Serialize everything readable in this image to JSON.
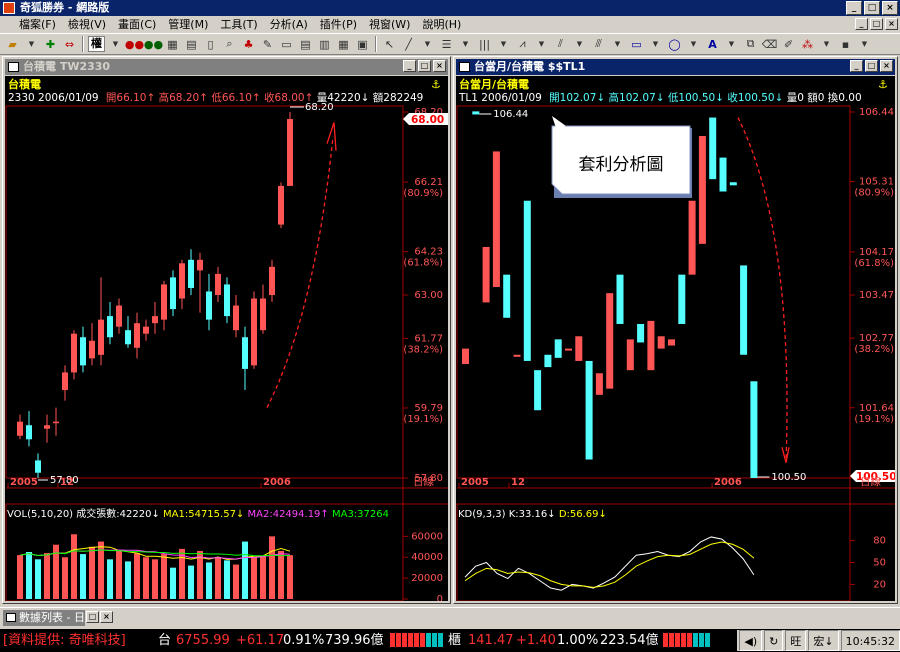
{
  "app": {
    "title": "奇狐勝券 - 網路版"
  },
  "menu": [
    "檔案(F)",
    "檢視(V)",
    "畫面(C)",
    "管理(M)",
    "工具(T)",
    "分析(A)",
    "插件(P)",
    "視窗(W)",
    "說明(H)"
  ],
  "toolbar": {
    "quan_label": "權"
  },
  "left_chart": {
    "window_title": "台積電 TW2330",
    "stock_name": "台積電",
    "info_line": {
      "code_date": "2330 2006/01/09",
      "open": "開66.10↑",
      "high": "高68.20↑",
      "low": "低66.10↑",
      "close": "收68.00↑",
      "vol": "量42220↓",
      "amt": "額282249"
    },
    "axis_labels": [
      {
        "v": "68.20",
        "pct": ""
      },
      {
        "v": "66.21",
        "pct": "(80.9%)"
      },
      {
        "v": "64.23",
        "pct": "(61.8%)"
      },
      {
        "v": "63.00",
        "pct": ""
      },
      {
        "v": "61.77",
        "pct": "(38.2%)"
      },
      {
        "v": "59.79",
        "pct": "(19.1%)"
      },
      {
        "v": "57.80",
        "pct": ""
      }
    ],
    "price_tag": "68.00",
    "high_label": "68.20",
    "low_label": "57.80",
    "x_labels": [
      "2005",
      "12",
      "2006"
    ],
    "period": "日線",
    "vol_header": {
      "title": "VOL(5,10,20) 成交張數:42220↓",
      "ma1": "MA1:54715.57↓",
      "ma2": "MA2:42494.19↑",
      "ma3": "MA3:37264"
    },
    "vol_axis": [
      "60000",
      "40000",
      "20000",
      "0"
    ]
  },
  "right_chart": {
    "window_title": "台當月/台積電 $$TL1",
    "stock_name": "台當月/台積電",
    "info_line": {
      "code_date": "TL1 2006/01/09",
      "open": "開102.07↓",
      "high": "高102.07↓",
      "low": "低100.50↓",
      "close": "收100.50↓",
      "vol": "量0",
      "amt": "額0",
      "chg": "換0.00"
    },
    "axis_labels": [
      {
        "v": "106.44",
        "pct": ""
      },
      {
        "v": "105.31",
        "pct": "(80.9%)"
      },
      {
        "v": "104.17",
        "pct": "(61.8%)"
      },
      {
        "v": "103.47",
        "pct": ""
      },
      {
        "v": "102.77",
        "pct": "(38.2%)"
      },
      {
        "v": "101.64",
        "pct": "(19.1%)"
      },
      {
        "v": "100.50",
        "pct": ""
      }
    ],
    "price_tag": "100.50",
    "high_label": "106.44",
    "low_label": "100.50",
    "x_labels": [
      "2005",
      "12",
      "2006"
    ],
    "period": "日線",
    "callout": "套利分析圖",
    "kd_header": {
      "title": "KD(9,3,3)",
      "k": "K:33.16↓",
      "d": "D:56.69↓"
    },
    "kd_axis": [
      "80",
      "50",
      "20"
    ]
  },
  "taskbar": {
    "tab_label": "數據列表 - 日"
  },
  "statusbar": {
    "provider": "[資料提供: 奇唯科技]",
    "idx1_name": "台",
    "idx1_value": "6755.99",
    "idx1_change": "+61.17",
    "idx1_pct": "0.91%",
    "idx1_amount": "739.96億",
    "idx2_name": "櫃",
    "idx2_value": "141.47",
    "idx2_change": "+1.40",
    "idx2_pct": "1.00%",
    "idx2_amount": "223.54億",
    "status_wang": "旺",
    "status_hong": "宏↓",
    "time": "10:45:32"
  },
  "colors": {
    "up": "#ff5555",
    "down": "#55ffff",
    "bg": "#000000",
    "axis": "#a00000",
    "ma1": "#ffff00",
    "ma2": "#ff44ff",
    "ma3": "#00ff00"
  }
}
